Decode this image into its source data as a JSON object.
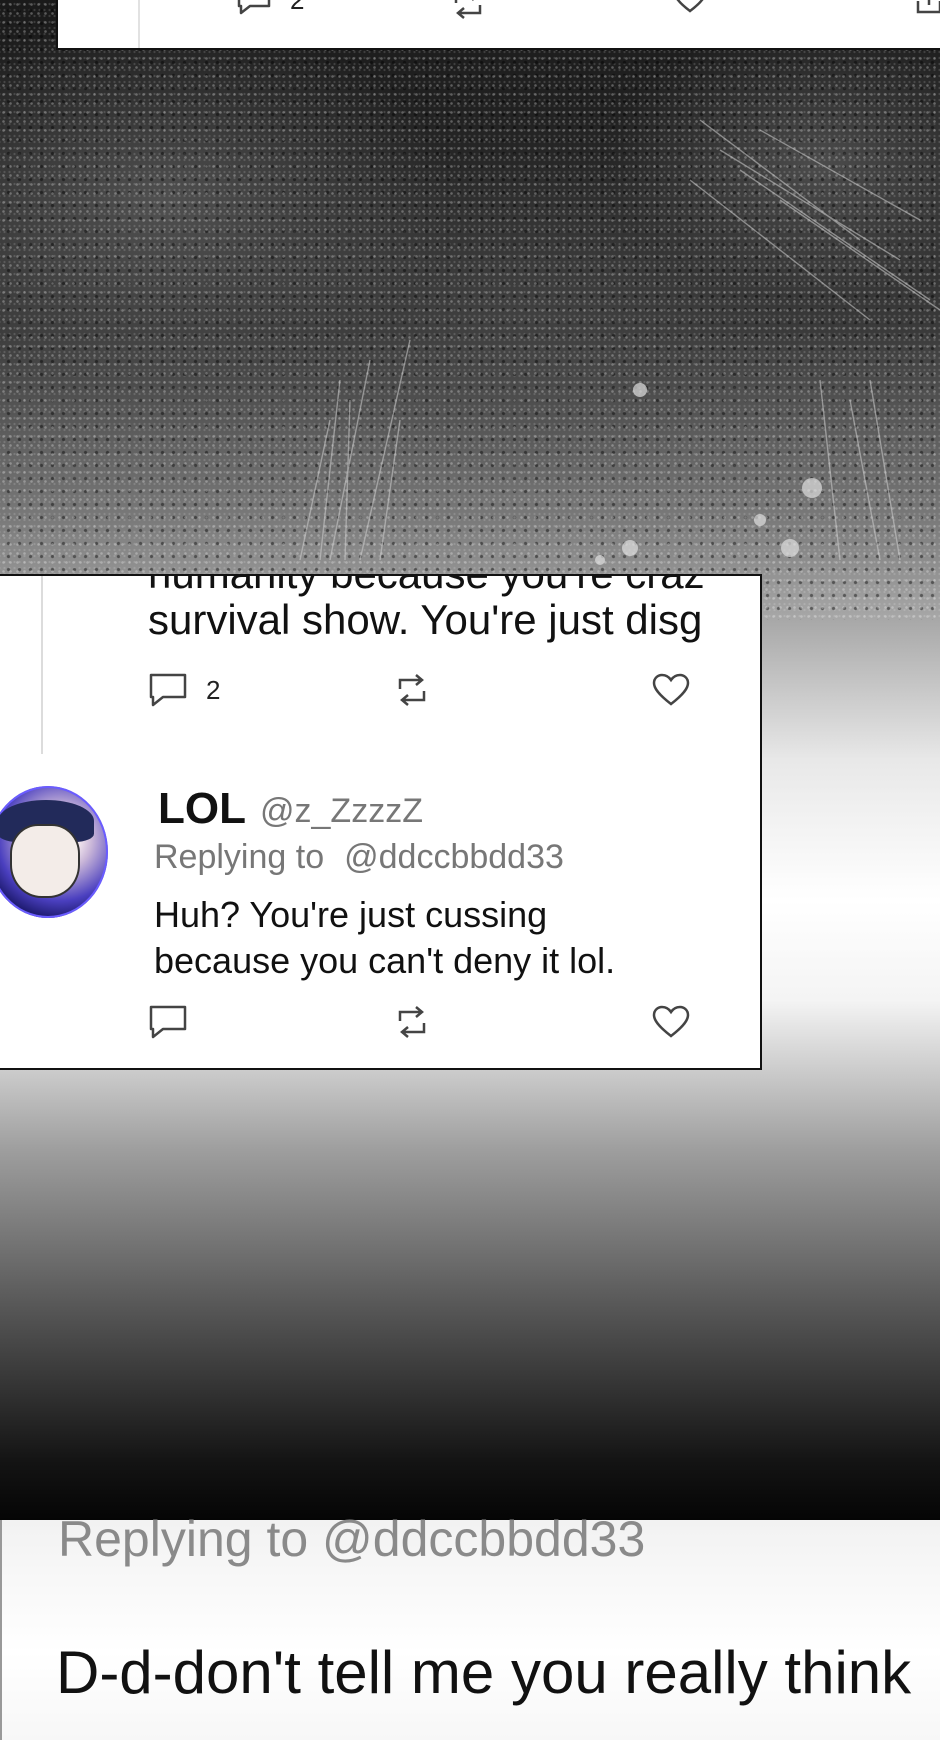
{
  "top_card": {
    "comment_count": "2"
  },
  "middle_card": {
    "cut_text": "humanity because you're craz",
    "tweet_text": "survival show. You're just disg",
    "reply_count": "2"
  },
  "reply": {
    "name": "LOL",
    "handle": "@z_ZzzzZ",
    "replying_label": "Replying to",
    "replying_to": "@ddccbbdd33",
    "text_line1": "Huh? You're just cussing",
    "text_line2": "because you can't deny it lol."
  },
  "bottom_card": {
    "replying": "Replying to @ddccbbdd33",
    "text": "D-d-don't tell me you really think"
  },
  "colors": {
    "card_bg": "#ffffff",
    "border": "#111111",
    "muted_text": "#777777"
  },
  "icons": [
    "comment-icon",
    "retweet-icon",
    "heart-icon",
    "share-icon"
  ]
}
